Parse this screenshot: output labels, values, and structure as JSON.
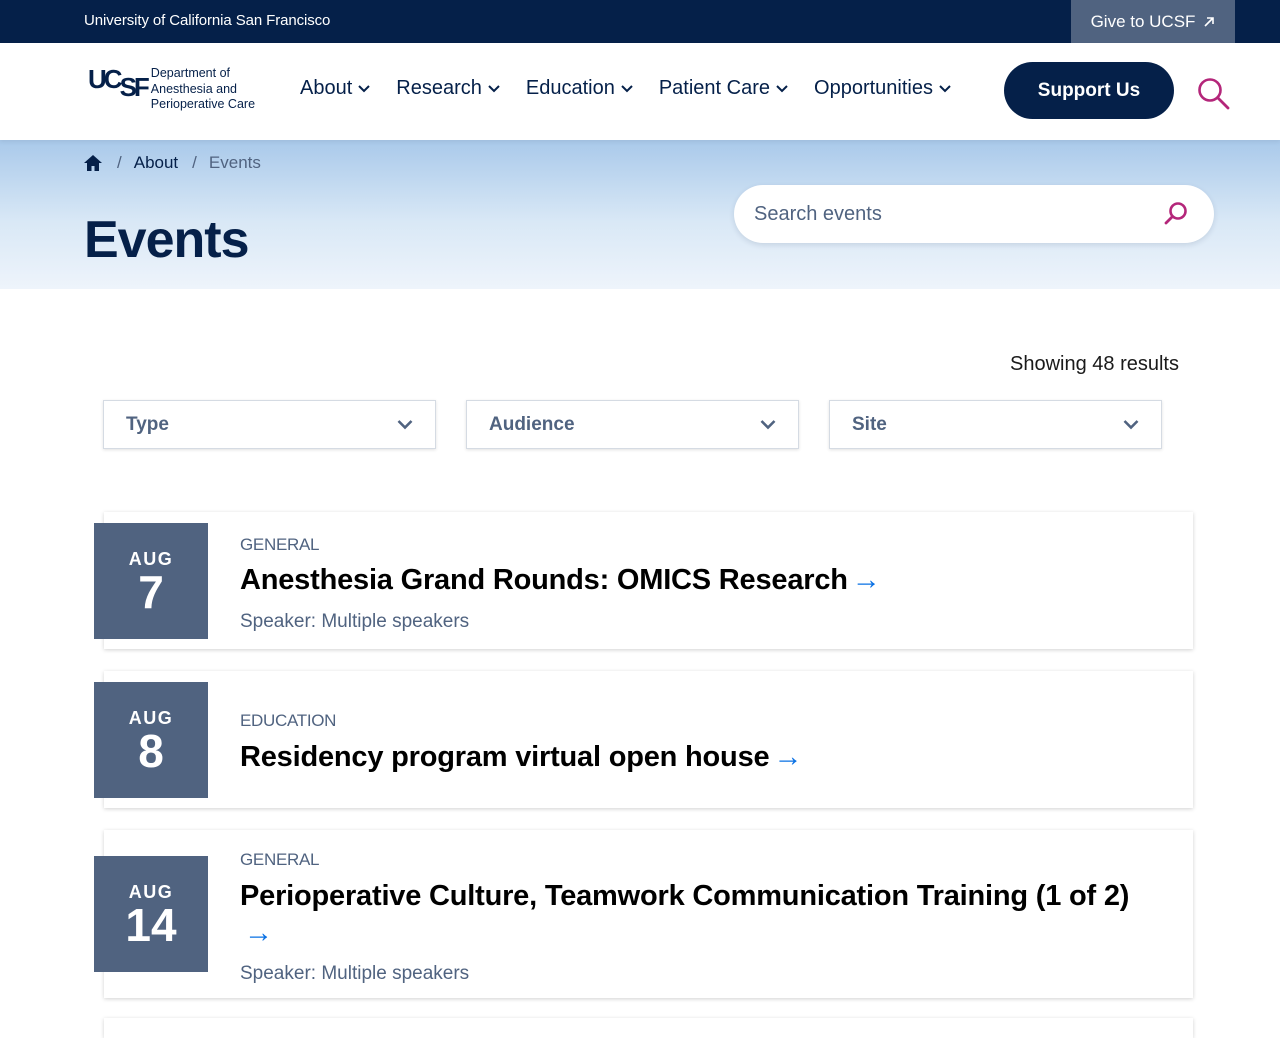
{
  "utility": {
    "university": "University of California San Francisco",
    "give_label": "Give to UCSF"
  },
  "header": {
    "logo_text": [
      "Department of",
      "Anesthesia and",
      "Perioperative Care"
    ],
    "nav": [
      {
        "label": "About"
      },
      {
        "label": "Research"
      },
      {
        "label": "Education"
      },
      {
        "label": "Patient Care"
      },
      {
        "label": "Opportunities"
      }
    ],
    "support_label": "Support Us"
  },
  "hero": {
    "breadcrumb": {
      "about": "About",
      "current": "Events"
    },
    "title": "Events",
    "search_placeholder": "Search events"
  },
  "results_text": "Showing 48 results",
  "filters": [
    {
      "label": "Type"
    },
    {
      "label": "Audience"
    },
    {
      "label": "Site"
    }
  ],
  "events": [
    {
      "month": "AUG",
      "day": "7",
      "category": "GENERAL",
      "title": "Anesthesia Grand Rounds: OMICS Research",
      "speaker": "Speaker: Multiple speakers"
    },
    {
      "month": "AUG",
      "day": "8",
      "category": "EDUCATION",
      "title": "Residency program virtual open house",
      "speaker": ""
    },
    {
      "month": "AUG",
      "day": "14",
      "category": "GENERAL",
      "title": "Perioperative Culture, Teamwork Communication Training (1 of 2)",
      "speaker": "Speaker: Multiple speakers"
    }
  ],
  "colors": {
    "navy": "#052049",
    "slate": "#506380",
    "accent_pink": "#b4267a",
    "link_blue": "#0a71e4"
  },
  "icons": {
    "give": "external-arrow-icon",
    "search": "magnifier-icon",
    "home": "home-icon",
    "dropdown": "chevron-down-icon",
    "link": "right-arrow-icon"
  }
}
